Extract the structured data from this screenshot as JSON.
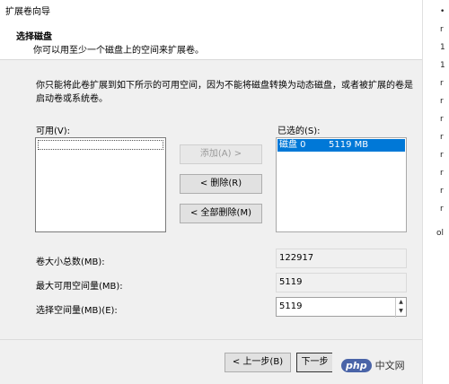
{
  "window": {
    "title": "扩展卷向导"
  },
  "header": {
    "title": "选择磁盘",
    "subtitle": "你可以用至少一个磁盘上的空间来扩展卷。"
  },
  "description": "你只能将此卷扩展到如下所示的可用空间，因为不能将磁盘转换为动态磁盘，或者被扩展的卷是启动卷或系统卷。",
  "available": {
    "label": "可用(V):",
    "items": []
  },
  "selected": {
    "label": "已选的(S):",
    "items": [
      {
        "disk": "磁盘 0",
        "size": "5119 MB"
      }
    ]
  },
  "buttons": {
    "add": "添加(A) >",
    "remove": "< 删除(R)",
    "remove_all": "< 全部删除(M)",
    "back": "< 上一步(B)",
    "next": "下一步"
  },
  "fields": {
    "total_size_label": "卷大小总数(MB):",
    "total_size_value": "122917",
    "max_space_label": "最大可用空间量(MB):",
    "max_space_value": "5119",
    "select_space_label": "选择空间量(MB)(E):",
    "select_space_value": "5119"
  },
  "right_edge_chars": [
    "•",
    "r",
    "1",
    "1",
    "r",
    "r",
    "r",
    "r",
    "r",
    "r",
    "r",
    "r",
    "ol"
  ],
  "watermark": {
    "logo": "php",
    "text": "中文网"
  }
}
